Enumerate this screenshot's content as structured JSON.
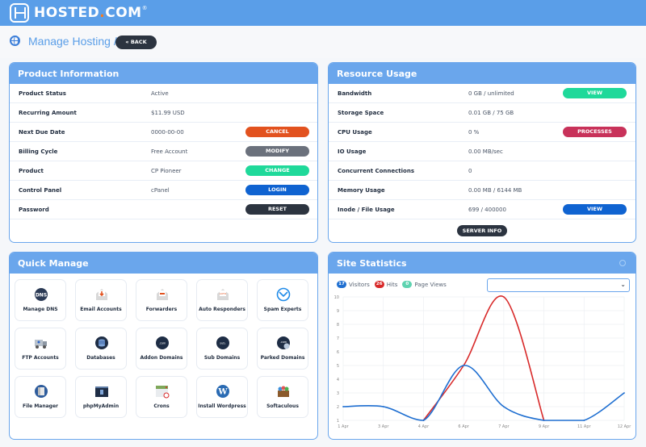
{
  "header": {
    "brand_main": "HOSTED",
    "brand_dot": ".",
    "brand_tail": "COM",
    "brand_reg": "®"
  },
  "breadcrumb": {
    "title": "Manage Hosting /",
    "back_label": "« BACK",
    "icon": "globe-icon"
  },
  "product_info": {
    "title": "Product Information",
    "rows": [
      {
        "label": "Product Status",
        "value": "Active"
      },
      {
        "label": "Recurring Amount",
        "value": "$11.99 USD"
      },
      {
        "label": "Next Due Date",
        "value": "0000-00-00",
        "button": "CANCEL",
        "color": "#e2521f"
      },
      {
        "label": "Billing Cycle",
        "value": "Free Account",
        "button": "MODIFY",
        "color": "#6b717c"
      },
      {
        "label": "Product",
        "value": "CP Pioneer",
        "button": "CHANGE",
        "color": "#1fd99a"
      },
      {
        "label": "Control Panel",
        "value": "cPanel",
        "button": "LOGIN",
        "color": "#0f63d1"
      },
      {
        "label": "Password",
        "value": "",
        "button": "RESET",
        "color": "#2c3440"
      }
    ]
  },
  "resource_usage": {
    "title": "Resource Usage",
    "rows": [
      {
        "label": "Bandwidth",
        "value": "0 GB / unlimited",
        "button": "VIEW",
        "color": "#1fd99a"
      },
      {
        "label": "Storage Space",
        "value": "0.01 GB / 75 GB"
      },
      {
        "label": "CPU Usage",
        "value": "0 %",
        "button": "PROCESSES",
        "color": "#c8325a"
      },
      {
        "label": "IO Usage",
        "value": "0.00 MB/sec"
      },
      {
        "label": "Concurrent Connections",
        "value": "0"
      },
      {
        "label": "Memory Usage",
        "value": "0.00 MB / 6144 MB"
      },
      {
        "label": "Inode / File Usage",
        "value": "699 / 400000",
        "button": "VIEW",
        "color": "#0f63d1"
      }
    ],
    "server_info_label": "SERVER INFO"
  },
  "quick_manage": {
    "title": "Quick Manage",
    "tiles": [
      {
        "label": "Manage DNS",
        "icon": "dns-icon"
      },
      {
        "label": "Email Accounts",
        "icon": "email-accounts-icon"
      },
      {
        "label": "Forwarders",
        "icon": "forwarders-icon"
      },
      {
        "label": "Auto Responders",
        "icon": "auto-responders-icon"
      },
      {
        "label": "Spam Experts",
        "icon": "spam-experts-icon"
      },
      {
        "label": "FTP Accounts",
        "icon": "ftp-truck-icon"
      },
      {
        "label": "Databases",
        "icon": "database-icon"
      },
      {
        "label": "Addon Domains",
        "icon": "addon-domains-icon"
      },
      {
        "label": "Sub Domains",
        "icon": "sub-domains-icon"
      },
      {
        "label": "Parked Domains",
        "icon": "parked-domains-icon"
      },
      {
        "label": "File Manager",
        "icon": "file-manager-icon"
      },
      {
        "label": "phpMyAdmin",
        "icon": "phpmyadmin-icon"
      },
      {
        "label": "Crons",
        "icon": "crons-calendar-icon"
      },
      {
        "label": "Install Wordpress",
        "icon": "wordpress-icon"
      },
      {
        "label": "Softaculous",
        "icon": "softaculous-icon"
      }
    ]
  },
  "site_statistics": {
    "title": "Site Statistics",
    "legend": [
      {
        "count": "17",
        "label": "Visitors",
        "color": "#1f6fd1"
      },
      {
        "count": "26",
        "label": "Hits",
        "color": "#d82a2a"
      },
      {
        "count": "0",
        "label": "Page Views",
        "color": "#5ed3b0"
      }
    ],
    "select_value": ""
  },
  "chart_data": {
    "type": "line",
    "title": "",
    "xlabel": "",
    "ylabel": "",
    "x": [
      "1 Apr",
      "3 Apr",
      "4 Apr",
      "6 Apr",
      "7 Apr",
      "9 Apr",
      "11 Apr",
      "12 Apr"
    ],
    "yticks": [
      1,
      2,
      3,
      4,
      5,
      6,
      7,
      8,
      9,
      10
    ],
    "ylim": [
      1,
      10
    ],
    "grid": true,
    "series": [
      {
        "name": "Visitors",
        "color": "#1f6fd1",
        "values": [
          2,
          2,
          1,
          5,
          2,
          1,
          1,
          3
        ]
      },
      {
        "name": "Hits",
        "color": "#d82a2a",
        "values": [
          null,
          null,
          1,
          5,
          10,
          1,
          null,
          null
        ]
      }
    ]
  }
}
